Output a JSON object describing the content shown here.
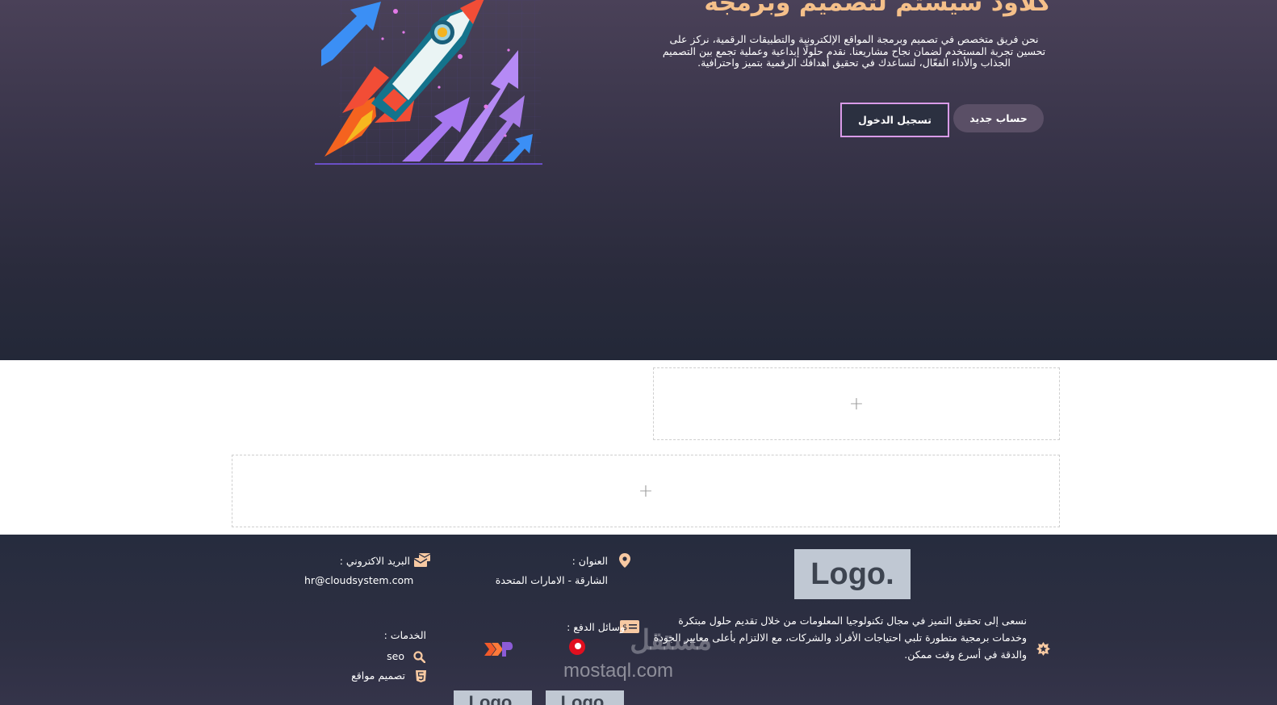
{
  "hero": {
    "title": "كلاود سيستم لتصميم وبرمجة",
    "description": "نحن فريق متخصص في تصميم وبرمجة المواقع الإلكترونية والتطبيقات الرقمية، نركز على تحسين تجربة المستخدم لضمان نجاح مشاريعنا. نقدم حلولًا إبداعية وعملية تجمع بين التصميم الجذاب والأداء الفعّال، لنساعدك في تحقيق أهدافك الرقمية بتميز واحترافية.",
    "login_label": "تسجيل الدخول",
    "register_label": "حساب جديد"
  },
  "builder": {
    "add_symbol": "+"
  },
  "footer": {
    "logo_text": "Logo.",
    "about": "نسعى إلى تحقيق التميز في مجال تكنولوجيا المعلومات من خلال تقديم حلول مبتكرة وخدمات برمجية متطورة تلبي احتياجات الأفراد والشركات، مع الالتزام بأعلى معايير الجودة والدقة في أسرع وقت ممكن.",
    "address_label": "العنوان :",
    "address_value": "الشارقة - الامارات المتحدة",
    "email_label": "البريد الاكتروني :",
    "email_value": "hr@cloudsystem.com",
    "payment_label": "وسائل الدفع :",
    "services_label": "الخدمات :",
    "services": [
      "seo",
      "تصميم مواقع"
    ],
    "partner_logos": [
      "Logo.",
      "Logo."
    ]
  },
  "watermark": {
    "arabic": "مستقل",
    "latin": "mostaql.com"
  },
  "colors": {
    "accent": "#f5c08a",
    "login_border": "#d99be8",
    "icon_peach": "#f7c9a2"
  },
  "icons": [
    "rocket-illustration",
    "location-pin-icon",
    "email-icon",
    "payment-card-icon",
    "search-icon",
    "html5-icon",
    "star-badge-icon"
  ]
}
